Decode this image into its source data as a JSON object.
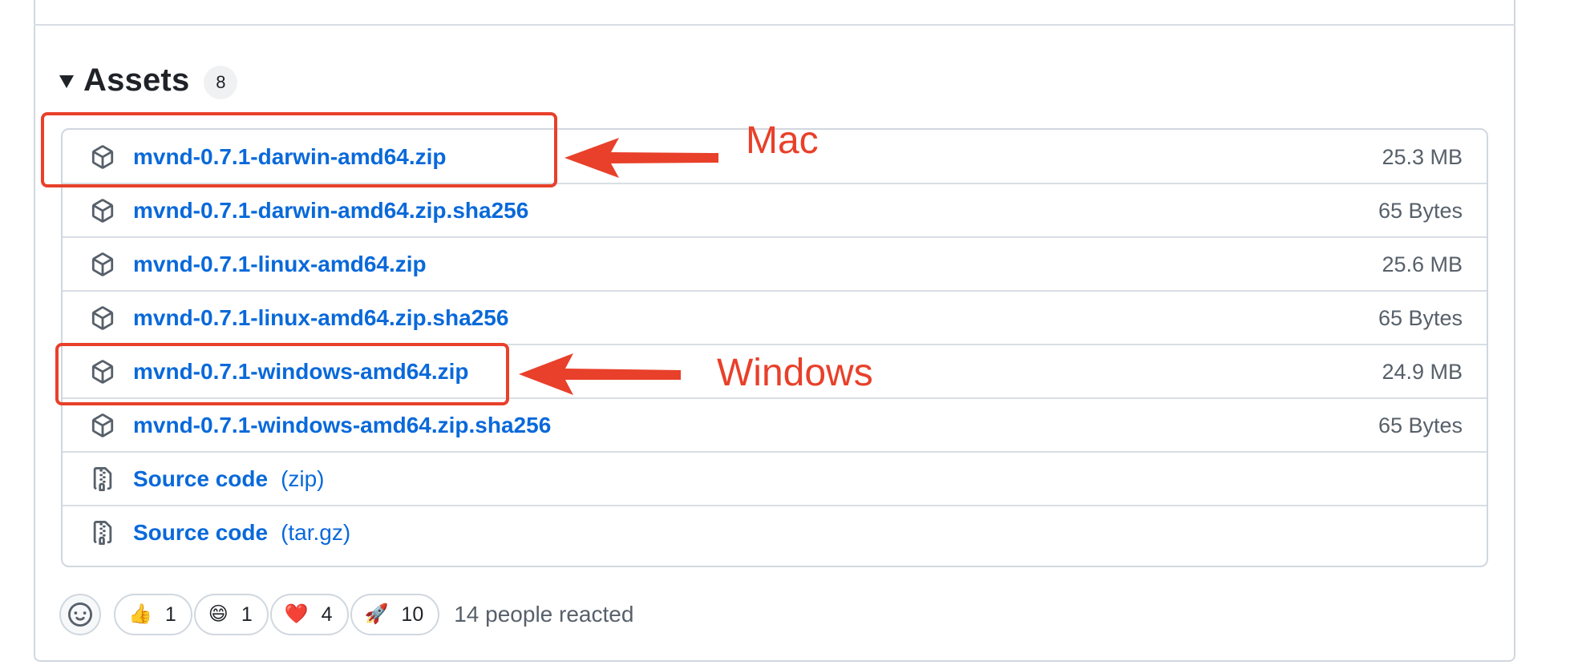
{
  "assets": {
    "title": "Assets",
    "count": "8",
    "items": [
      {
        "name": "mvnd-0.7.1-darwin-amd64.zip",
        "size": "25.3 MB",
        "icon": "package-icon"
      },
      {
        "name": "mvnd-0.7.1-darwin-amd64.zip.sha256",
        "size": "65 Bytes",
        "icon": "package-icon"
      },
      {
        "name": "mvnd-0.7.1-linux-amd64.zip",
        "size": "25.6 MB",
        "icon": "package-icon"
      },
      {
        "name": "mvnd-0.7.1-linux-amd64.zip.sha256",
        "size": "65 Bytes",
        "icon": "package-icon"
      },
      {
        "name": "mvnd-0.7.1-windows-amd64.zip",
        "size": "24.9 MB",
        "icon": "package-icon"
      },
      {
        "name": "mvnd-0.7.1-windows-amd64.zip.sha256",
        "size": "65 Bytes",
        "icon": "package-icon"
      },
      {
        "name": "Source code",
        "format": "(zip)",
        "icon": "file-zip-icon"
      },
      {
        "name": "Source code",
        "format": "(tar.gz)",
        "icon": "file-zip-icon"
      }
    ]
  },
  "annotations": {
    "mac_label": "Mac",
    "windows_label": "Windows",
    "color": "#e8402a"
  },
  "reactions": {
    "items": [
      {
        "emoji": "👍",
        "count": "1"
      },
      {
        "emoji": "😄",
        "count": "1"
      },
      {
        "emoji": "❤️",
        "count": "4"
      },
      {
        "emoji": "🚀",
        "count": "10"
      }
    ],
    "summary": "14 people reacted"
  },
  "colors": {
    "link": "#0969da",
    "muted": "#57606a",
    "border": "#d0d7de"
  }
}
